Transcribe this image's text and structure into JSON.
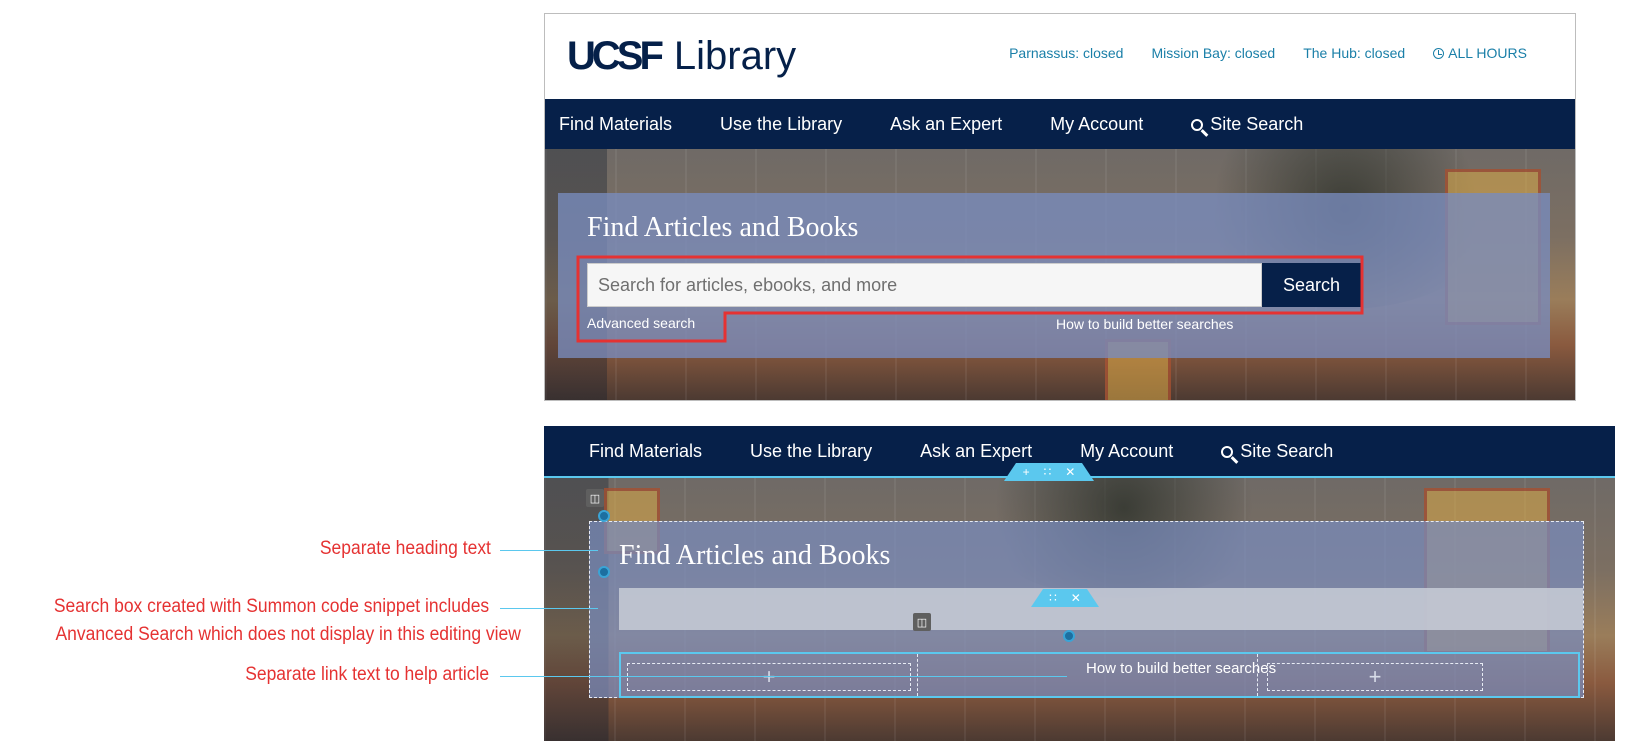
{
  "top": {
    "logo": {
      "ucsf": "UCSF",
      "library": "Library"
    },
    "hours": [
      {
        "label": "Parnassus: closed"
      },
      {
        "label": "Mission Bay: closed"
      },
      {
        "label": "The Hub: closed"
      },
      {
        "label": "ALL HOURS"
      }
    ],
    "nav": [
      "Find Materials",
      "Use the Library",
      "Ask an Expert",
      "My Account",
      "Site Search"
    ],
    "hero_title": "Find Articles and Books",
    "search_placeholder": "Search for articles, ebooks, and more",
    "search_button": "Search",
    "advanced_search": "Advanced search",
    "tip_link": "How to build better searches"
  },
  "bottom": {
    "nav": [
      "Find Materials",
      "Use the Library",
      "Ask an Expert",
      "My Account",
      "Site Search"
    ],
    "hero_title": "Find Articles and Books",
    "tip_link": "How to build better searches",
    "toolbar_icons": [
      "plus-icon",
      "drag-handle-icon",
      "close-icon"
    ],
    "layout_icon": "layout-columns-icon",
    "plus_glyph": "+"
  },
  "annotations": {
    "heading": "Separate heading text",
    "search_line1": "Search box created with Summon code snippet includes",
    "search_line2": "Anvanced Search which does not display in this editing view",
    "link": "Separate link text to help article"
  },
  "colors": {
    "navy": "#062049",
    "link_blue": "#1a7fa8",
    "annotation_red": "#e53232",
    "editor_cyan": "#5bc8ee",
    "panel_blue": "#788cbe"
  }
}
